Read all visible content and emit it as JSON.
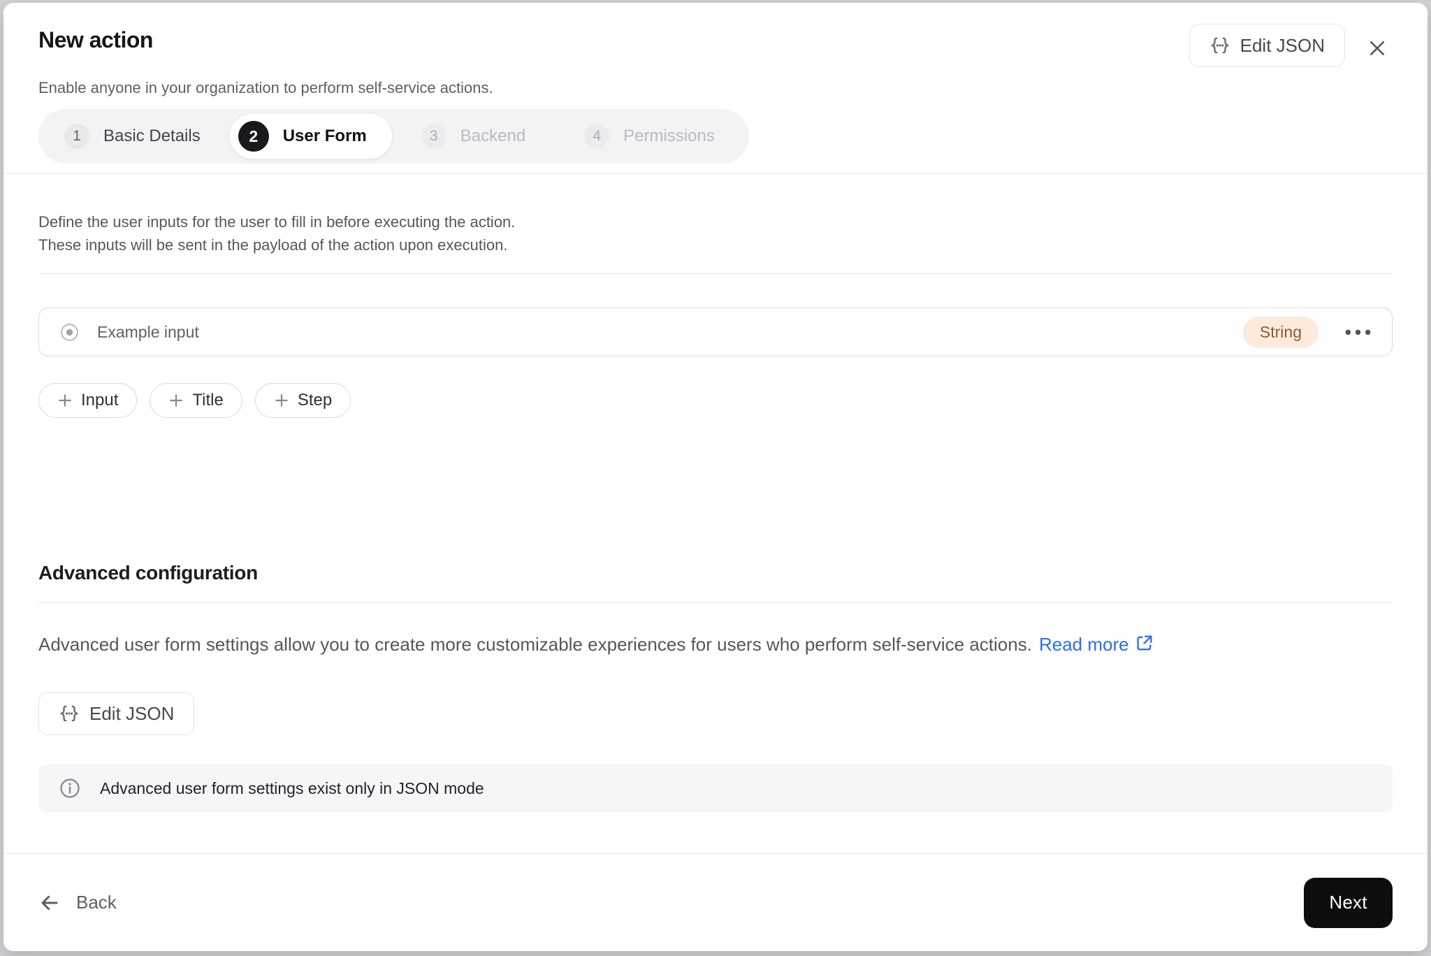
{
  "header": {
    "title": "New action",
    "subtitle": "Enable anyone in your organization to perform self-service actions.",
    "edit_json_button": "Edit JSON"
  },
  "stepper": {
    "steps": [
      {
        "number": "1",
        "label": "Basic Details",
        "state": "visited"
      },
      {
        "number": "2",
        "label": "User Form",
        "state": "active"
      },
      {
        "number": "3",
        "label": "Backend",
        "state": "upcoming"
      },
      {
        "number": "4",
        "label": "Permissions",
        "state": "upcoming"
      }
    ]
  },
  "user_form": {
    "description_line1": "Define the user inputs for the user to fill in before executing the action.",
    "description_line2": "These inputs will be sent in the payload of the action upon execution.",
    "inputs": [
      {
        "label": "Example input",
        "type": "String"
      }
    ],
    "add_buttons": [
      {
        "label": "Input"
      },
      {
        "label": "Title"
      },
      {
        "label": "Step"
      }
    ]
  },
  "advanced": {
    "title": "Advanced configuration",
    "description": "Advanced user form settings allow you to create more customizable experiences for users who perform self-service actions.",
    "read_more": "Read more",
    "edit_json_button": "Edit JSON",
    "info_banner": "Advanced user form settings exist only in JSON mode"
  },
  "footer": {
    "back": "Back",
    "next": "Next"
  },
  "icons": {
    "edit_json": "braces-ellipsis-icon",
    "close": "x-icon",
    "input_row": "radio-icon",
    "row_menu": "ellipsis-icon",
    "add": "plus-icon",
    "read_more": "external-link-icon",
    "info": "info-circle-icon",
    "back": "arrow-left-icon"
  },
  "colors": {
    "link_blue": "#2a6cf4",
    "string_badge_bg": "#fcebdd",
    "string_badge_text": "#8a5a35",
    "next_button_bg": "#0c0d0e",
    "active_step_bg": "#17191c",
    "stepper_bg": "#f2f3f5",
    "info_banner_bg": "#f5f6f8"
  }
}
